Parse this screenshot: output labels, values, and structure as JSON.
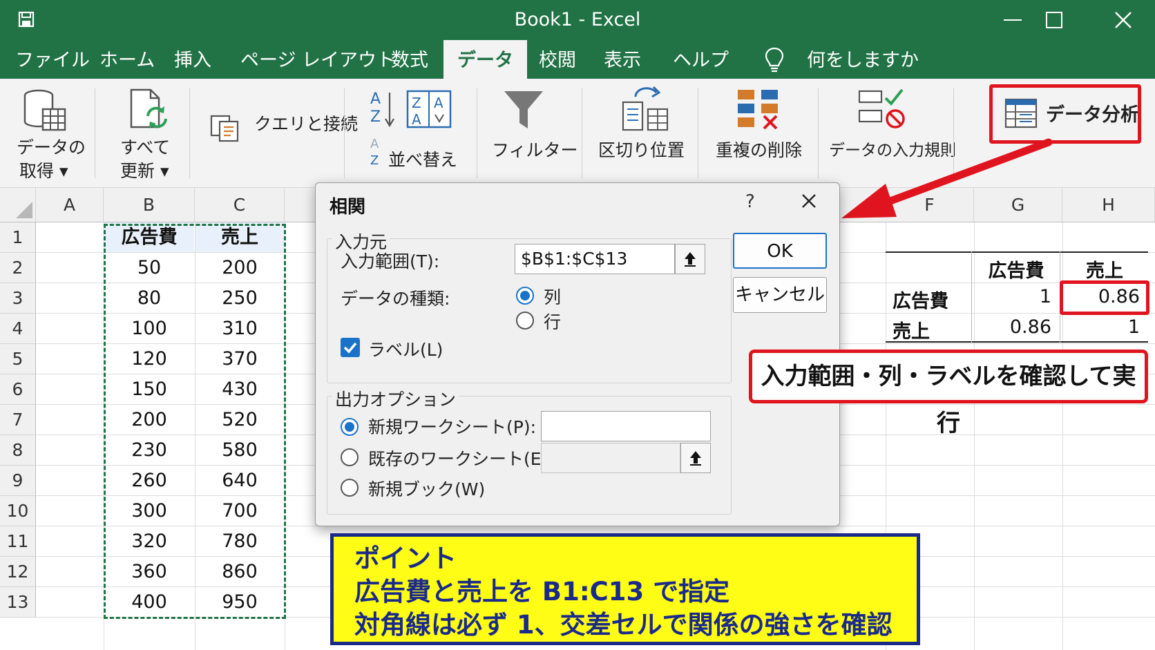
{
  "window": {
    "title": "Book1  -  Excel"
  },
  "menu": {
    "tabs": [
      "ファイル",
      "ホーム",
      "挿入",
      "ページ レイアウト",
      "数式",
      "データ",
      "校閲",
      "表示",
      "ヘルプ"
    ],
    "active_tab": "データ",
    "tell_me": "何をしますか"
  },
  "ribbon": {
    "get_data": [
      "データの",
      "取得 ▾"
    ],
    "refresh_all": [
      "すべて",
      "更新 ▾"
    ],
    "queries": "クエリと接続",
    "sort": "並べ替え",
    "filter": "フィルター",
    "text_to_columns": "区切り位置",
    "remove_duplicates": "重複の削除",
    "data_validation": "データの入力規則",
    "data_analysis": "データ分析",
    "sort_az_icon_a": "A",
    "sort_az_icon_z": "Z"
  },
  "sheet": {
    "columns": [
      "A",
      "B",
      "C",
      "F",
      "G",
      "H"
    ],
    "rows": [
      "1",
      "2",
      "3",
      "4",
      "5",
      "6",
      "7",
      "8",
      "9",
      "10",
      "11",
      "12",
      "13"
    ],
    "headers": {
      "b1": "広告費",
      "c1": "売上"
    },
    "ad_spend": [
      "50",
      "80",
      "100",
      "120",
      "150",
      "200",
      "230",
      "260",
      "300",
      "320",
      "360",
      "400"
    ],
    "sales": [
      "200",
      "250",
      "310",
      "370",
      "430",
      "520",
      "580",
      "640",
      "700",
      "780",
      "860",
      "950"
    ]
  },
  "correlation_table": {
    "col_headers": [
      "広告費",
      "売上"
    ],
    "rows": [
      {
        "label": "広告費",
        "values": [
          "1",
          "0.86"
        ]
      },
      {
        "label": "売上",
        "values": [
          "0.86",
          "1"
        ]
      }
    ]
  },
  "dialog": {
    "title": "相関",
    "help": "?",
    "input_group": "入力元",
    "input_range_label": "入力範囲(T):",
    "input_range_value": "$B$1:$C$13",
    "grouped_by_label": "データの種類:",
    "grouped_columns": "列",
    "grouped_rows": "行",
    "labels_checkbox": "ラベル(L)",
    "output_group": "出力オプション",
    "new_sheet": "新規ワークシート(P):",
    "existing_sheet": "既存のワークシート(E):",
    "new_book": "新規ブック(W)",
    "ok": "OK",
    "cancel": "キャンセル"
  },
  "annotations": {
    "callout": "入力範囲・列・ラベルを確認して実行",
    "point_lines": [
      "ポイント",
      "広告費と売上を B1:C13 で指定",
      "対角線は必ず 1、交差セルで関係の強さを確認"
    ]
  },
  "colors": {
    "excel_green": "#217346",
    "red": "#e0141e",
    "point_bg": "#fffc16",
    "point_border": "#1a2a8a",
    "check_blue": "#1a73c9"
  }
}
